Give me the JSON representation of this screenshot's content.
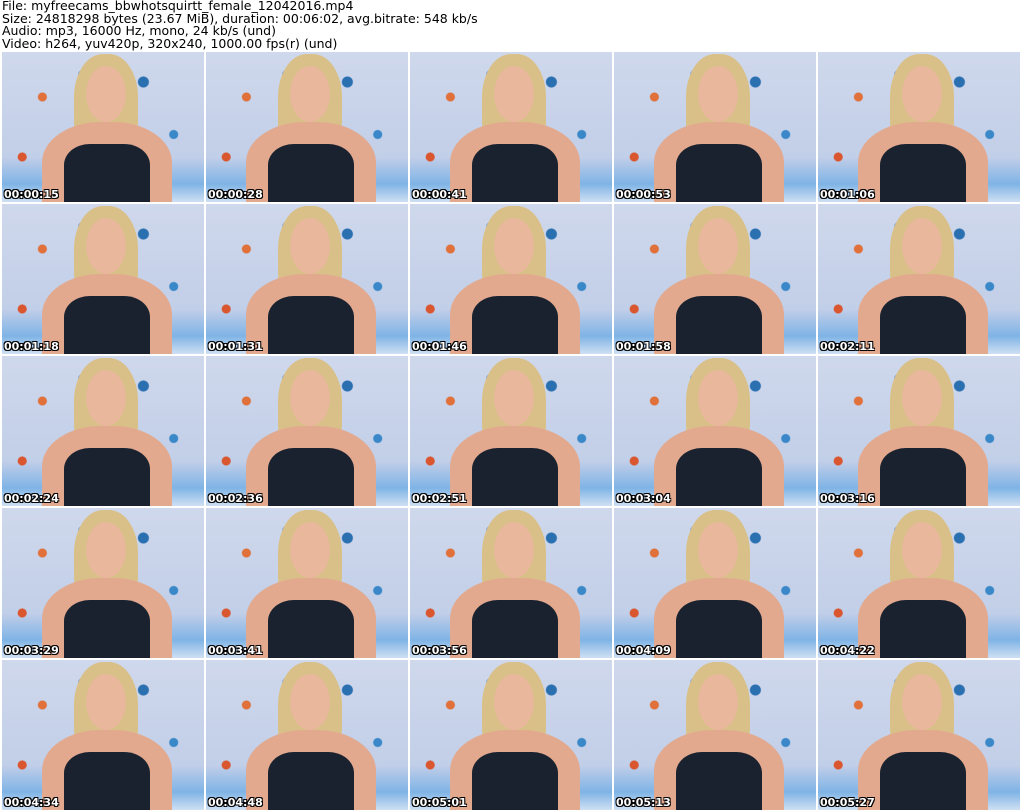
{
  "header": {
    "file": "File: myfreecams_bbwhotsquirtt_female_12042016.mp4",
    "size": "Size: 24818298 bytes (23.67 MiB), duration: 00:06:02, avg.bitrate: 548 kb/s",
    "audio": "Audio: mp3, 16000 Hz, mono, 24 kb/s (und)",
    "video": "Video: h264, yuv420p, 320x240, 1000.00 fps(r) (und)"
  },
  "thumbnails": [
    "00:00:15",
    "00:00:28",
    "00:00:41",
    "00:00:53",
    "00:01:06",
    "00:01:18",
    "00:01:31",
    "00:01:46",
    "00:01:58",
    "00:02:11",
    "00:02:24",
    "00:02:36",
    "00:02:51",
    "00:03:04",
    "00:03:16",
    "00:03:29",
    "00:03:41",
    "00:03:56",
    "00:04:09",
    "00:04:22",
    "00:04:34",
    "00:04:48",
    "00:05:01",
    "00:05:13",
    "00:05:27"
  ]
}
